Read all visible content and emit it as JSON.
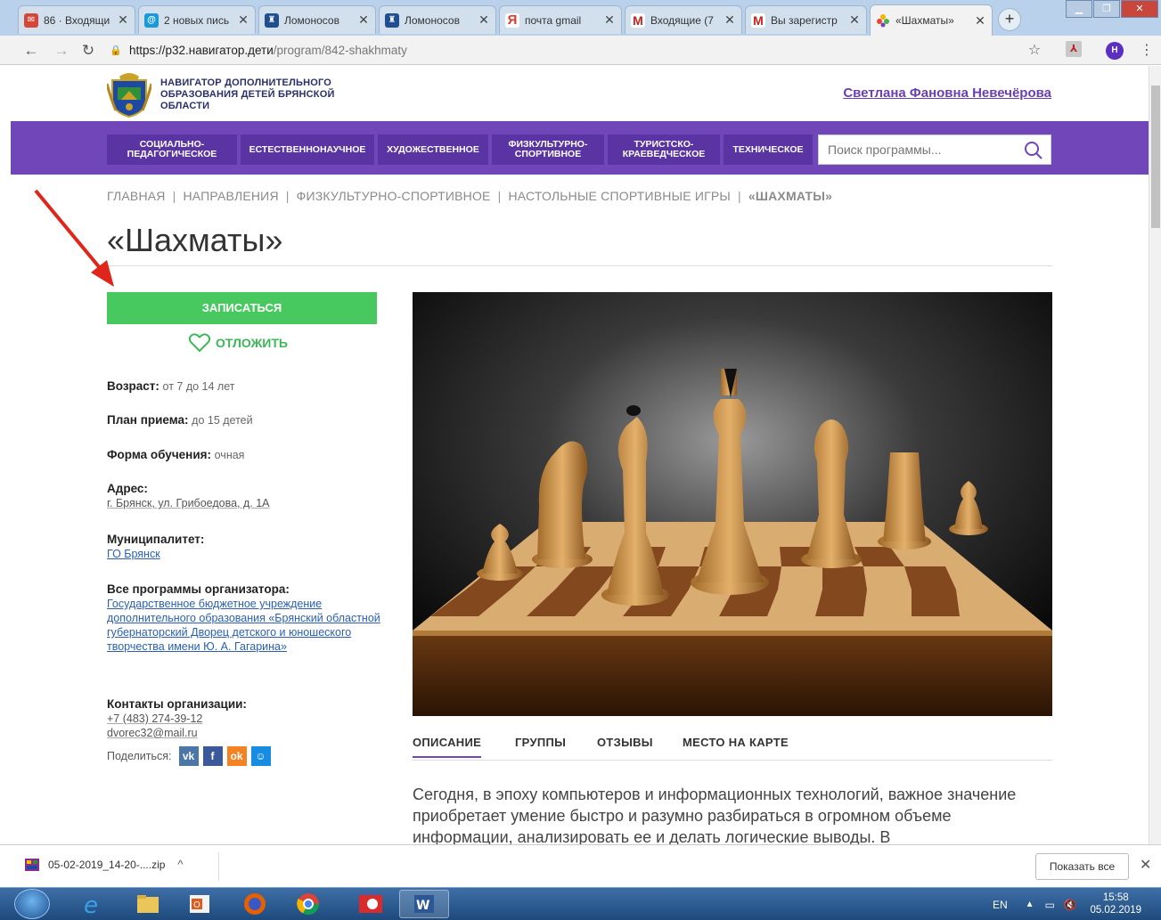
{
  "browser": {
    "tabs": [
      {
        "title": "86 · Входящи",
        "icon_color": "#d44638",
        "icon": "mail-icon"
      },
      {
        "title": "2 новых пись",
        "icon_color": "#1a9ad8",
        "icon": "at-icon"
      },
      {
        "title": "Ломоносов",
        "icon_color": "#1f4f8f",
        "icon": "crest-icon"
      },
      {
        "title": "Ломоносов",
        "icon_color": "#1f4f8f",
        "icon": "crest-icon"
      },
      {
        "title": "почта gmail",
        "icon_color": "#e03a2f",
        "icon": "yandex-icon"
      },
      {
        "title": "Входящие (7",
        "icon_color": "#c5221f",
        "icon": "gmail-icon"
      },
      {
        "title": "Вы зарегистр",
        "icon_color": "#c5221f",
        "icon": "gmail-icon"
      },
      {
        "title": "«Шахматы»",
        "icon_color": "#f4b400",
        "icon": "navigator-icon",
        "active": true
      }
    ],
    "url_host": "https://р32.навигатор.дети",
    "url_path": "/program/842-shakhmaty",
    "profile_initial": "Н"
  },
  "site": {
    "logo_text": "НАВИГАТОР ДОПОЛНИТЕЛЬНОГО ОБРАЗОВАНИЯ ДЕТЕЙ БРЯНСКОЙ ОБЛАСТИ",
    "user_name": "Светлана Фановна Невечёрова",
    "directions": [
      "СОЦИАЛЬНО-ПЕДАГОГИЧЕСКОЕ",
      "ЕСТЕСТВЕННОНАУЧНОЕ",
      "ХУДОЖЕСТВЕННОЕ",
      "ФИЗКУЛЬТУРНО-СПОРТИВНОЕ",
      "ТУРИСТСКО-КРАЕВЕДЧЕСКОЕ",
      "ТЕХНИЧЕСКОЕ"
    ],
    "search_placeholder": "Поиск программы..."
  },
  "breadcrumb": [
    "ГЛАВНАЯ",
    "НАПРАВЛЕНИЯ",
    "ФИЗКУЛЬТУРНО-СПОРТИВНОЕ",
    "НАСТОЛЬНЫЕ СПОРТИВНЫЕ ИГРЫ",
    "«ШАХМАТЫ»"
  ],
  "program": {
    "title": "«Шахматы»",
    "enroll_label": "ЗАПИСАТЬСЯ",
    "postpone_label": "ОТЛОЖИТЬ",
    "age_label": "Возраст:",
    "age_value": "от 7 до 14 лет",
    "plan_label": "План приема:",
    "plan_value": "до 15 детей",
    "form_label": "Форма обучения:",
    "form_value": "очная",
    "address_label": "Адрес:",
    "address_value": "г. Брянск, ул. Грибоедова, д. 1А",
    "municipality_label": "Муниципалитет:",
    "municipality_value": "ГО Брянск",
    "organizer_label": "Все программы организатора:",
    "organizer_value": "Государственное бюджетное учреждение дополнительного образования «Брянский областной губернаторский Дворец детского и юношеского творчества имени Ю. А. Гагарина»",
    "contacts_label": "Контакты организации:",
    "phone": "+7 (483) 274-39-12",
    "email": "dvorec32@mail.ru",
    "share_label": "Поделиться:",
    "tabs": [
      "ОПИСАНИЕ",
      "ГРУППЫ",
      "ОТЗЫВЫ",
      "МЕСТО НА КАРТЕ"
    ],
    "description": "Сегодня, в эпоху компьютеров и информационных технологий, важное значение приобретает умение быстро и разумно разбираться в огромном объеме информации, анализировать ее и делать логические выводы. В"
  },
  "downloads": {
    "file": "05-02-2019_14-20-....zip",
    "show_all": "Показать все"
  },
  "taskbar": {
    "lang": "EN",
    "time": "15:58",
    "date": "05.02.2019"
  },
  "colors": {
    "accent_purple": "#7046b9",
    "enroll_green": "#48c95f",
    "link_blue": "#2a5fb5"
  }
}
